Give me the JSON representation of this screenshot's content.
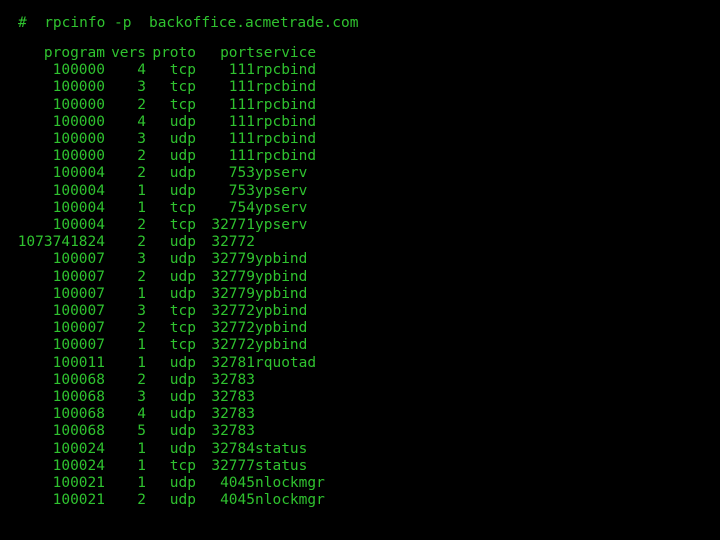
{
  "terminal": {
    "background_color": "#000000",
    "text_color": "#2fc22f",
    "prompt_symbol": "#",
    "command": "rpcinfo -p  backoffice.acmetrade.com",
    "full_command_line": "#  rpcinfo -p  backoffice.acmetrade.com"
  },
  "table": {
    "headers": {
      "program": "program",
      "vers": "vers",
      "proto": "proto",
      "port": "port",
      "service": "service"
    },
    "rows": [
      {
        "program": "100000",
        "vers": "4",
        "proto": "tcp",
        "port": "111",
        "service": "rpcbind"
      },
      {
        "program": "100000",
        "vers": "3",
        "proto": "tcp",
        "port": "111",
        "service": "rpcbind"
      },
      {
        "program": "100000",
        "vers": "2",
        "proto": "tcp",
        "port": "111",
        "service": "rpcbind"
      },
      {
        "program": "100000",
        "vers": "4",
        "proto": "udp",
        "port": "111",
        "service": "rpcbind"
      },
      {
        "program": "100000",
        "vers": "3",
        "proto": "udp",
        "port": "111",
        "service": "rpcbind"
      },
      {
        "program": "100000",
        "vers": "2",
        "proto": "udp",
        "port": "111",
        "service": "rpcbind"
      },
      {
        "program": "100004",
        "vers": "2",
        "proto": "udp",
        "port": "753",
        "service": "ypserv"
      },
      {
        "program": "100004",
        "vers": "1",
        "proto": "udp",
        "port": "753",
        "service": "ypserv"
      },
      {
        "program": "100004",
        "vers": "1",
        "proto": "tcp",
        "port": "754",
        "service": "ypserv"
      },
      {
        "program": "100004",
        "vers": "2",
        "proto": "tcp",
        "port": "32771",
        "service": "ypserv"
      },
      {
        "program": "1073741824",
        "vers": "2",
        "proto": "udp",
        "port": "32772",
        "service": ""
      },
      {
        "program": "100007",
        "vers": "3",
        "proto": "udp",
        "port": "32779",
        "service": "ypbind"
      },
      {
        "program": "100007",
        "vers": "2",
        "proto": "udp",
        "port": "32779",
        "service": "ypbind"
      },
      {
        "program": "100007",
        "vers": "1",
        "proto": "udp",
        "port": "32779",
        "service": "ypbind"
      },
      {
        "program": "100007",
        "vers": "3",
        "proto": "tcp",
        "port": "32772",
        "service": "ypbind"
      },
      {
        "program": "100007",
        "vers": "2",
        "proto": "tcp",
        "port": "32772",
        "service": "ypbind"
      },
      {
        "program": "100007",
        "vers": "1",
        "proto": "tcp",
        "port": "32772",
        "service": "ypbind"
      },
      {
        "program": "100011",
        "vers": "1",
        "proto": "udp",
        "port": "32781",
        "service": "rquotad"
      },
      {
        "program": "100068",
        "vers": "2",
        "proto": "udp",
        "port": "32783",
        "service": ""
      },
      {
        "program": "100068",
        "vers": "3",
        "proto": "udp",
        "port": "32783",
        "service": ""
      },
      {
        "program": "100068",
        "vers": "4",
        "proto": "udp",
        "port": "32783",
        "service": ""
      },
      {
        "program": "100068",
        "vers": "5",
        "proto": "udp",
        "port": "32783",
        "service": ""
      },
      {
        "program": "100024",
        "vers": "1",
        "proto": "udp",
        "port": "32784",
        "service": "status"
      },
      {
        "program": "100024",
        "vers": "1",
        "proto": "tcp",
        "port": "32777",
        "service": "status"
      },
      {
        "program": "100021",
        "vers": "1",
        "proto": "udp",
        "port": "4045",
        "service": "nlockmgr"
      },
      {
        "program": "100021",
        "vers": "2",
        "proto": "udp",
        "port": "4045",
        "service": "nlockmgr"
      }
    ]
  }
}
